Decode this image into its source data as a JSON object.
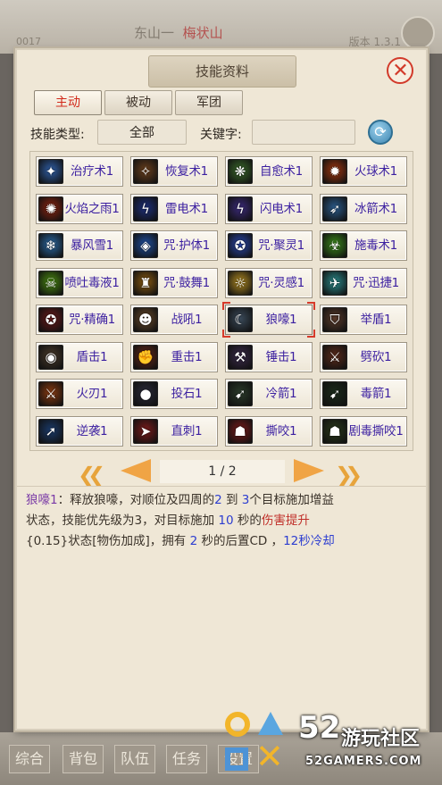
{
  "background": {
    "map_name_a": "东山一",
    "map_name_b": "梅状山",
    "left_text": "0017",
    "right_text": "版本 1.3.1",
    "bottom_tabs": [
      "综合",
      "背包",
      "队伍",
      "任务",
      "设置"
    ]
  },
  "panel": {
    "title": "技能资料",
    "close_symbol": "✕",
    "tabs": [
      {
        "label": "主动",
        "active": true
      },
      {
        "label": "被动",
        "active": false
      },
      {
        "label": "军团",
        "active": false
      }
    ],
    "filter": {
      "type_label": "技能类型:",
      "type_value": "全部",
      "keyword_label": "关键字:",
      "keyword_value": ""
    },
    "skills": [
      {
        "name": "治疗术1",
        "icon": "heal-icon",
        "color": "#2f5fa8",
        "glyph": "✦"
      },
      {
        "name": "恢复术1",
        "icon": "restore-icon",
        "color": "#6a3f1c",
        "glyph": "✧"
      },
      {
        "name": "自愈术1",
        "icon": "self-heal-icon",
        "color": "#3a6a2a",
        "glyph": "❋"
      },
      {
        "name": "火球术1",
        "icon": "fireball-icon",
        "color": "#a1360f",
        "glyph": "✹"
      },
      {
        "name": "火焰之雨1",
        "icon": "fire-rain-icon",
        "color": "#8c2410",
        "glyph": "✺"
      },
      {
        "name": "雷电术1",
        "icon": "thunder-icon",
        "color": "#1d2f7a",
        "glyph": "ϟ"
      },
      {
        "name": "闪电术1",
        "icon": "lightning-icon",
        "color": "#3b2a7a",
        "glyph": "ϟ"
      },
      {
        "name": "冰箭术1",
        "icon": "ice-arrow-icon",
        "color": "#2a5a8a",
        "glyph": "➶"
      },
      {
        "name": "暴风雪1",
        "icon": "blizzard-icon",
        "color": "#2a6aa6",
        "glyph": "❄"
      },
      {
        "name": "咒·护体1",
        "icon": "shield-curse-icon",
        "color": "#1f4fa0",
        "glyph": "◈"
      },
      {
        "name": "咒·聚灵1",
        "icon": "gather-spirit-icon",
        "color": "#2a48b0",
        "glyph": "✪"
      },
      {
        "name": "施毒术1",
        "icon": "poison-icon",
        "color": "#3a8a1a",
        "glyph": "☣"
      },
      {
        "name": "喷吐毒液1",
        "icon": "venom-spit-icon",
        "color": "#4a8a10",
        "glyph": "☠"
      },
      {
        "name": "咒·鼓舞1",
        "icon": "inspire-icon",
        "color": "#8a5a10",
        "glyph": "♜"
      },
      {
        "name": "咒·灵感1",
        "icon": "inspiration-icon",
        "color": "#b08a20",
        "glyph": "☼"
      },
      {
        "name": "咒·迅捷1",
        "icon": "swift-icon",
        "color": "#2a8a8a",
        "glyph": "✈"
      },
      {
        "name": "咒·精确1",
        "icon": "precision-icon",
        "color": "#6a1a1a",
        "glyph": "✪"
      },
      {
        "name": "战吼1",
        "icon": "war-cry-icon",
        "color": "#6a4a2a",
        "glyph": "☻"
      },
      {
        "name": "狼嚎1",
        "icon": "wolf-howl-icon",
        "color": "#3a4a5a",
        "glyph": "☾"
      },
      {
        "name": "举盾1",
        "icon": "raise-shield-icon",
        "color": "#5a3a2a",
        "glyph": "⛉"
      },
      {
        "name": "盾击1",
        "icon": "shield-bash-icon",
        "color": "#4a3a2a",
        "glyph": "◉"
      },
      {
        "name": "重击1",
        "icon": "heavy-strike-icon",
        "color": "#6a2a1a",
        "glyph": "✊"
      },
      {
        "name": "锤击1",
        "icon": "hammer-icon",
        "color": "#3a2a4a",
        "glyph": "⚒"
      },
      {
        "name": "劈砍1",
        "icon": "cleave-icon",
        "color": "#5a2a1a",
        "glyph": "⚔"
      },
      {
        "name": "火刃1",
        "icon": "fire-blade-icon",
        "color": "#8a3a10",
        "glyph": "⚔"
      },
      {
        "name": "投石1",
        "icon": "throw-stone-icon",
        "color": "#2a2a3a",
        "glyph": "●"
      },
      {
        "name": "冷箭1",
        "icon": "cold-arrow-icon",
        "color": "#2a3a2a",
        "glyph": "➹"
      },
      {
        "name": "毒箭1",
        "icon": "poison-arrow-icon",
        "color": "#1a2a1a",
        "glyph": "➹"
      },
      {
        "name": "逆袭1",
        "icon": "counter-attack-icon",
        "color": "#1a3a6a",
        "glyph": "➚"
      },
      {
        "name": "直刺1",
        "icon": "thrust-icon",
        "color": "#7a1a1a",
        "glyph": "➤"
      },
      {
        "name": "撕咬1",
        "icon": "bite-icon",
        "color": "#7a1a1a",
        "glyph": "☗"
      },
      {
        "name": "剧毒撕咬1",
        "icon": "toxic-bite-icon",
        "color": "#2a3a1a",
        "glyph": "☗"
      }
    ],
    "selected_skill": "狼嚎1",
    "pager": {
      "text": "1 / 2"
    },
    "description": {
      "line1_a": "狼嚎1",
      "line1_b": "：释放狼嚎，对顺位及四周的",
      "line1_c": "2",
      "line1_d": " 到 ",
      "line1_e": "3",
      "line1_f": "个目标施加增益",
      "line2_a": "状态，技能优先级为3，对目标施加 ",
      "line2_b": "10",
      "line2_c": " 秒的",
      "line2_d": "伤害提升",
      "line3_a": "{0.15}状态[物伤加成]，拥有 ",
      "line3_b": "2",
      "line3_c": " 秒的后置CD ，",
      "line3_d": "12秒冷却"
    }
  },
  "watermark": {
    "number": "52",
    "name": "游玩社区",
    "site": "52GAMERS.COM"
  }
}
